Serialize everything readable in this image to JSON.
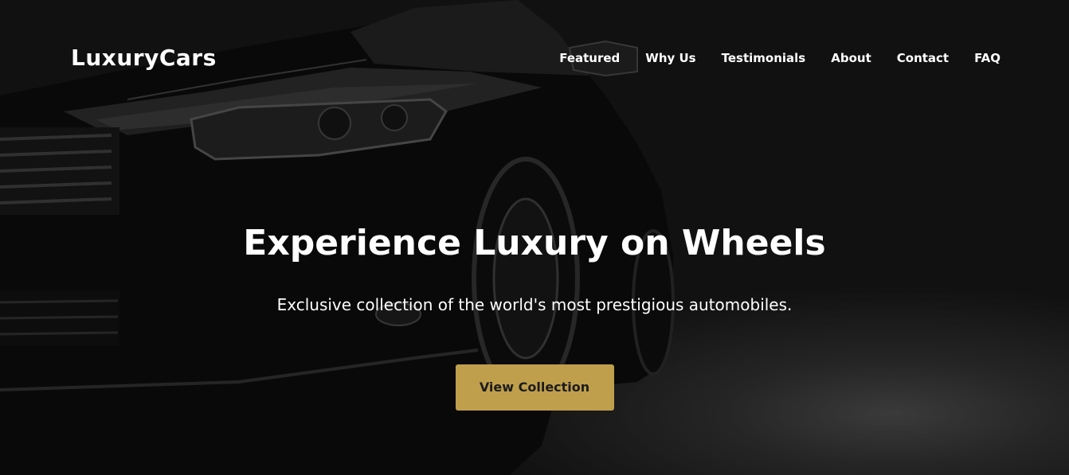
{
  "nav": {
    "brand": "LuxuryCars",
    "links": [
      "Featured",
      "Why Us",
      "Testimonials",
      "About",
      "Contact",
      "FAQ"
    ]
  },
  "hero": {
    "title": "Experience Luxury on Wheels",
    "subtitle": "Exclusive collection of the world's most prestigious automobiles.",
    "cta_label": "View Collection",
    "background": "car-photo"
  },
  "colors": {
    "accent": "#bf9f4c",
    "background": "#141414",
    "text": "#ffffff"
  }
}
